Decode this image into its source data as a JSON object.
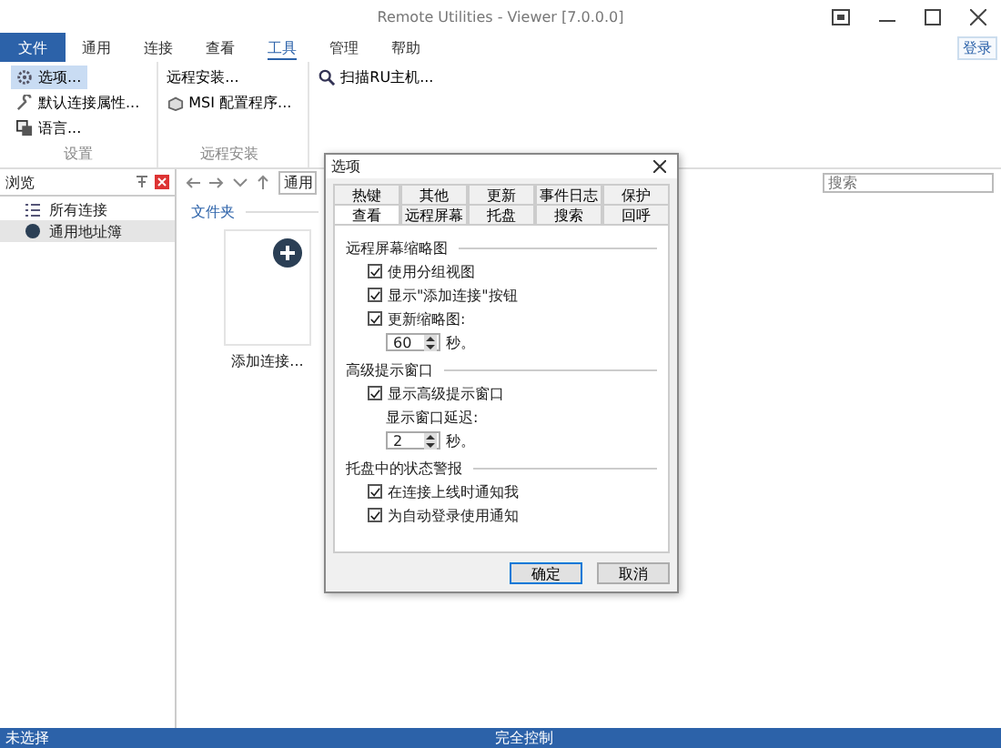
{
  "window": {
    "title": "Remote Utilities - Viewer [7.0.0.0]"
  },
  "menu_tabs": [
    {
      "label": "文件",
      "kind": "file",
      "selected": false
    },
    {
      "label": "通用",
      "kind": "tab",
      "selected": false
    },
    {
      "label": "连接",
      "kind": "tab",
      "selected": false
    },
    {
      "label": "查看",
      "kind": "tab",
      "selected": false
    },
    {
      "label": "工具",
      "kind": "tab",
      "selected": true
    },
    {
      "label": "管理",
      "kind": "tab",
      "selected": false
    },
    {
      "label": "帮助",
      "kind": "tab",
      "selected": false
    }
  ],
  "login": "登录",
  "ribbon": [
    {
      "label": "设置",
      "items": [
        {
          "label": "选项...",
          "selected": true
        },
        {
          "label": "默认连接属性...",
          "selected": false
        },
        {
          "label": "语言...",
          "selected": false
        }
      ]
    },
    {
      "label": "远程安装",
      "items": [
        {
          "label": "远程安装...",
          "selected": false
        },
        {
          "label": "MSI 配置程序...",
          "selected": false
        }
      ]
    },
    {
      "items": [
        {
          "label": "扫描RU主机...",
          "selected": false
        }
      ]
    }
  ],
  "sidebar": {
    "title": "浏览",
    "items": [
      {
        "label": "所有连接",
        "selected": false
      },
      {
        "label": "通用地址簿",
        "selected": true
      }
    ]
  },
  "address": "通用",
  "search": {
    "placeholder": "搜索"
  },
  "folder": {
    "title": "文件夹",
    "tile": "添加连接..."
  },
  "dialog": {
    "title": "选项",
    "tab_rows": [
      [
        {
          "label": "热键",
          "selected": false
        },
        {
          "label": "其他",
          "selected": false
        },
        {
          "label": "更新",
          "selected": false
        },
        {
          "label": "事件日志",
          "selected": false
        },
        {
          "label": "保护",
          "selected": false
        }
      ],
      [
        {
          "label": "查看",
          "selected": true
        },
        {
          "label": "远程屏幕",
          "selected": false
        },
        {
          "label": "托盘",
          "selected": false
        },
        {
          "label": "搜索",
          "selected": false
        },
        {
          "label": "回呼",
          "selected": false
        }
      ]
    ],
    "sections": [
      {
        "title": "远程屏幕缩略图",
        "options": [
          {
            "kind": "checkbox",
            "label": "使用分组视图",
            "checked": true
          },
          {
            "kind": "checkbox",
            "label": "显示\"添加连接\"按钮",
            "checked": true
          },
          {
            "kind": "checkbox",
            "label": "更新缩略图:",
            "checked": true
          },
          {
            "kind": "spin",
            "value": "60",
            "unit": "秒。"
          }
        ]
      },
      {
        "title": "高级提示窗口",
        "options": [
          {
            "kind": "checkbox",
            "label": "显示高级提示窗口",
            "checked": true
          },
          {
            "kind": "label",
            "label": "显示窗口延迟:"
          },
          {
            "kind": "spin",
            "value": "2",
            "unit": "秒。"
          }
        ]
      },
      {
        "title": "托盘中的状态警报",
        "options": [
          {
            "kind": "checkbox",
            "label": "在连接上线时通知我",
            "checked": true
          },
          {
            "kind": "checkbox",
            "label": "为自动登录使用通知",
            "checked": true
          }
        ]
      }
    ],
    "buttons": [
      {
        "label": "确定",
        "kind": "default"
      },
      {
        "label": "取消",
        "kind": "normal"
      }
    ]
  },
  "status_bar": {
    "left": "未选择",
    "center": "完全控制"
  }
}
